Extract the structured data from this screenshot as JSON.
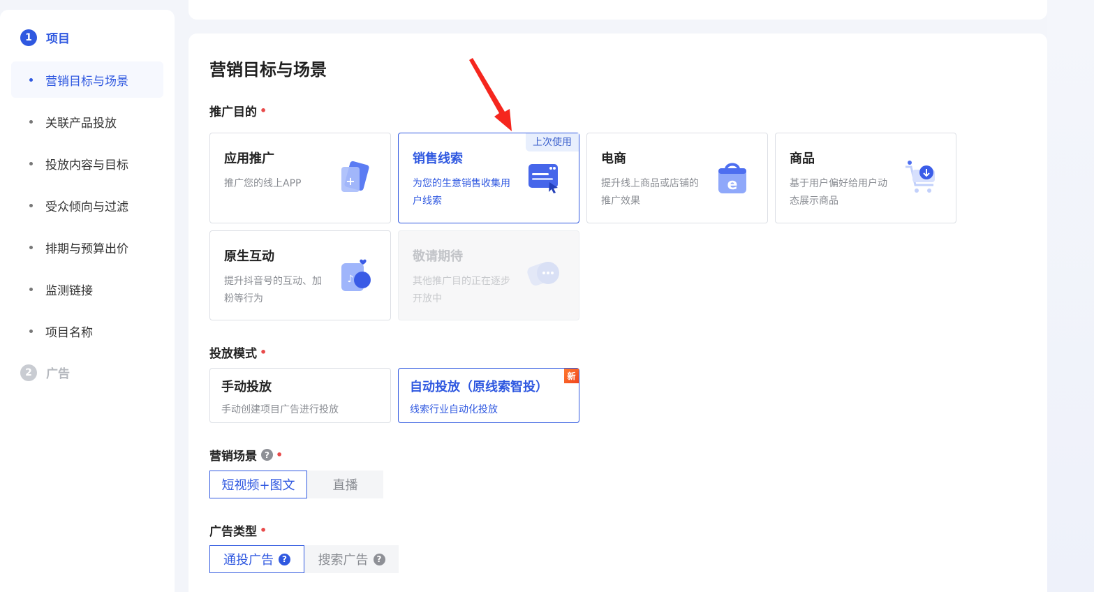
{
  "sidebar": {
    "steps": [
      {
        "num": "1",
        "label": "项目"
      },
      {
        "num": "2",
        "label": "广告"
      }
    ],
    "items": [
      {
        "label": "营销目标与场景"
      },
      {
        "label": "关联产品投放"
      },
      {
        "label": "投放内容与目标"
      },
      {
        "label": "受众倾向与过滤"
      },
      {
        "label": "排期与预算出价"
      },
      {
        "label": "监测链接"
      },
      {
        "label": "项目名称"
      }
    ]
  },
  "main": {
    "title": "营销目标与场景",
    "purpose": {
      "label": "推广目的",
      "required": "•",
      "last_used_tag": "上次使用",
      "cards": [
        {
          "title": "应用推广",
          "desc": "推广您的线上APP",
          "icon": "app-cards-icon"
        },
        {
          "title": "销售线索",
          "desc": "为您的生意销售收集用户线索",
          "icon": "webpage-cursor-icon"
        },
        {
          "title": "电商",
          "desc": "提升线上商品或店铺的推广效果",
          "icon": "shopping-bag-e-icon"
        },
        {
          "title": "商品",
          "desc": "基于用户偏好给用户动态展示商品",
          "icon": "shopping-cart-icon"
        },
        {
          "title": "原生互动",
          "desc": "提升抖音号的互动、加粉等行为",
          "icon": "douyin-heart-icon"
        },
        {
          "title": "敬请期待",
          "desc": "其他推广目的正在逐步开放中",
          "icon": "chat-bubble-icon"
        }
      ]
    },
    "mode": {
      "label": "投放模式",
      "required": "•",
      "new_badge": "新",
      "cards": [
        {
          "title": "手动投放",
          "desc": "手动创建项目广告进行投放"
        },
        {
          "title": "自动投放（原线索智投）",
          "desc": "线索行业自动化投放"
        }
      ]
    },
    "scene": {
      "label": "营销场景",
      "help": "?",
      "required": "•",
      "options": [
        "短视频+图文",
        "直播"
      ]
    },
    "ad_type": {
      "label": "广告类型",
      "required": "•",
      "options": [
        "通投广告",
        "搜索广告"
      ],
      "help": "?"
    }
  },
  "colors": {
    "accent": "#2f58e0",
    "required": "#e84a4a",
    "arrow": "#f5261e"
  }
}
